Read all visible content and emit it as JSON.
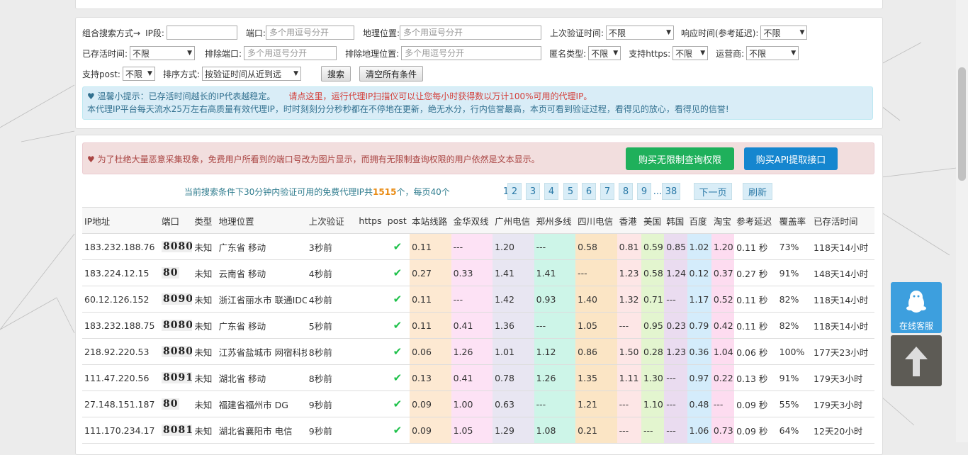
{
  "filters": {
    "combo_label": "组合搜索方式→",
    "ip_label": "IP段:",
    "ip_value": "",
    "port_label": "端口:",
    "port_placeholder": "多个用逗号分开",
    "geo_label": "地理位置:",
    "geo_placeholder": "多个用逗号分开",
    "last_verify_label": "上次验证时间:",
    "last_verify_value": "不限",
    "resp_label": "响应时间(参考延迟):",
    "resp_value": "不限",
    "alive_label": "已存活时间:",
    "alive_value": "不限",
    "excl_port_label": "排除端口:",
    "excl_port_placeholder": "多个用逗号分开",
    "excl_geo_label": "排除地理位置:",
    "excl_geo_placeholder": "多个用逗号分开",
    "anon_label": "匿名类型:",
    "anon_value": "不限",
    "https_label": "支持https:",
    "https_value": "不限",
    "isp_label": "运营商:",
    "isp_value": "不限",
    "post_label": "支持post:",
    "post_value": "不限",
    "sort_label": "排序方式:",
    "sort_value": "按验证时间从近到远",
    "search_btn": "搜索",
    "clear_btn": "清空所有条件"
  },
  "tip": {
    "heart_icon": "♥",
    "line1": "温馨小提示：已存活时间越长的IP代表越稳定。",
    "line1_red": "请点这里，运行代理IP扫描仪可以让您每小时获得数以万计100%可用的代理IP。",
    "line2": "本代理IP平台每天流水25万左右高质量有效代理IP，时时刻刻分分秒秒都在不停地在更新，绝无水分，行内信誉最高，本页可看到验证过程，看得见的放心，看得见的信誉!"
  },
  "notice": {
    "text": "为了杜绝大量恶意采集现象，免费用户所看到的端口号改为图片显示，而拥有无限制查询权限的用户依然是文本显示。",
    "buy_unlimited": "购买无限制查询权限",
    "buy_api": "购买API提取接口"
  },
  "pager": {
    "caption_pre": "当前搜索条件下30分钟内验证可用的免费代理IP共",
    "total": "1515",
    "caption_post": "个，每页40个",
    "pages": [
      "1",
      "2",
      "3",
      "4",
      "5",
      "6",
      "7",
      "8",
      "9",
      "...",
      "38"
    ],
    "next": "下一页",
    "refresh": "刷新"
  },
  "table": {
    "headers": [
      "IP地址",
      "端口",
      "类型",
      "地理位置",
      "上次验证",
      "https",
      "post",
      "本站线路",
      "金华双线",
      "广州电信",
      "郑州多线",
      "四川电信",
      "香港",
      "美国",
      "韩国",
      "百度",
      "淘宝",
      "参考延迟",
      "覆盖率",
      "已存活时间"
    ],
    "rows": [
      [
        "183.232.188.76",
        "8080",
        "未知",
        "广东省 移动",
        "3秒前",
        "",
        "✔",
        "0.11",
        "---",
        "1.20",
        "---",
        "0.58",
        "0.81",
        "0.59",
        "0.85",
        "1.02",
        "1.20",
        "0.11 秒",
        "73%",
        "118天14小时"
      ],
      [
        "183.224.12.15",
        "80",
        "未知",
        "云南省 移动",
        "4秒前",
        "",
        "✔",
        "0.27",
        "0.33",
        "1.41",
        "1.41",
        "---",
        "1.23",
        "0.58",
        "1.24",
        "0.12",
        "0.37",
        "0.27 秒",
        "91%",
        "148天14小时"
      ],
      [
        "60.12.126.152",
        "8090",
        "未知",
        "浙江省丽水市 联通IDC",
        "4秒前",
        "",
        "✔",
        "0.11",
        "---",
        "1.42",
        "0.93",
        "1.40",
        "1.32",
        "0.71",
        "---",
        "1.17",
        "0.52",
        "0.11 秒",
        "82%",
        "118天14小时"
      ],
      [
        "183.232.188.75",
        "8080",
        "未知",
        "广东省 移动",
        "5秒前",
        "",
        "✔",
        "0.11",
        "0.41",
        "1.36",
        "---",
        "1.05",
        "---",
        "0.95",
        "0.23",
        "0.79",
        "0.42",
        "0.11 秒",
        "82%",
        "118天14小时"
      ],
      [
        "218.92.220.53",
        "8080",
        "未知",
        "江苏省盐城市 网宿科技",
        "8秒前",
        "",
        "✔",
        "0.06",
        "1.26",
        "1.01",
        "1.12",
        "0.86",
        "1.50",
        "0.28",
        "1.23",
        "0.36",
        "1.04",
        "0.06 秒",
        "100%",
        "177天23小时"
      ],
      [
        "111.47.220.56",
        "8091",
        "未知",
        "湖北省 移动",
        "8秒前",
        "",
        "✔",
        "0.13",
        "0.41",
        "0.78",
        "1.26",
        "1.35",
        "1.11",
        "1.30",
        "---",
        "0.97",
        "0.22",
        "0.13 秒",
        "91%",
        "179天3小时"
      ],
      [
        "27.148.151.187",
        "80",
        "未知",
        "福建省福州市 DG",
        "9秒前",
        "",
        "✔",
        "0.09",
        "1.00",
        "0.63",
        "---",
        "1.21",
        "---",
        "1.10",
        "---",
        "0.48",
        "---",
        "0.09 秒",
        "55%",
        "179天3小时"
      ],
      [
        "111.170.234.17",
        "8081",
        "未知",
        "湖北省襄阳市 电信",
        "9秒前",
        "",
        "✔",
        "0.09",
        "1.05",
        "1.29",
        "1.08",
        "0.21",
        "---",
        "---",
        "---",
        "1.06",
        "0.73",
        "0.09 秒",
        "64%",
        "12天20小时"
      ]
    ]
  },
  "side": {
    "service_label": "在线客服",
    "service_icon": "qq-penguin-icon",
    "top_icon": "arrow-up-icon"
  },
  "colors": {
    "col_bg": [
      "",
      "",
      "",
      "",
      "",
      "",
      "",
      "#fde9d2",
      "#fde2f5",
      "#e8e6f2",
      "#cdf5e8",
      "#fbe5c5",
      "#fde6e6",
      "#e3f5cf",
      "#eadcf0",
      "#d4ecfb",
      "#fddcf0",
      "",
      "",
      ""
    ]
  }
}
